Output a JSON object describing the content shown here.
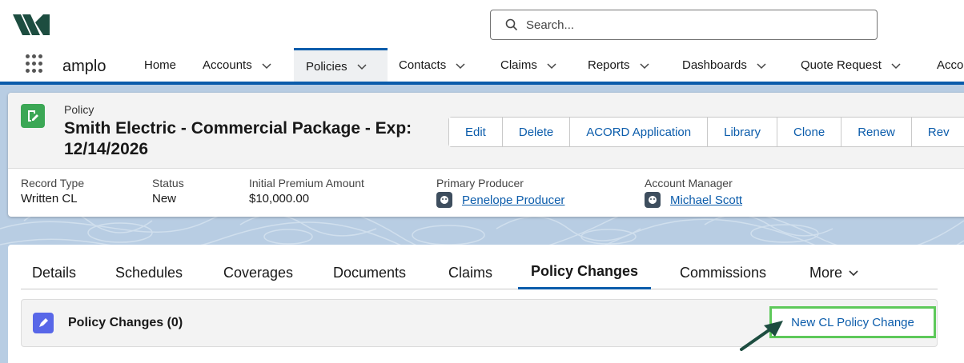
{
  "search": {
    "placeholder": "Search..."
  },
  "nav": {
    "app_name": "amplo",
    "items": [
      {
        "label": "Home"
      },
      {
        "label": "Accounts"
      },
      {
        "label": "Policies"
      },
      {
        "label": "Contacts"
      },
      {
        "label": "Claims"
      },
      {
        "label": "Reports"
      },
      {
        "label": "Dashboards"
      },
      {
        "label": "Quote Request"
      },
      {
        "label": "Acco"
      }
    ],
    "active": "Policies"
  },
  "record": {
    "object_label": "Policy",
    "title": "Smith Electric - Commercial Package - Exp: 12/14/2026",
    "buttons": [
      "Edit",
      "Delete",
      "ACORD Application",
      "Library",
      "Clone",
      "Renew",
      "Rev"
    ],
    "fields": [
      {
        "label": "Record Type",
        "value": "Written CL"
      },
      {
        "label": "Status",
        "value": "New"
      },
      {
        "label": "Initial Premium Amount",
        "value": "$10,000.00"
      },
      {
        "label": "Primary Producer",
        "value": "Penelope Producer"
      },
      {
        "label": "Account Manager",
        "value": "Michael Scott"
      }
    ]
  },
  "tabs": {
    "items": [
      "Details",
      "Schedules",
      "Coverages",
      "Documents",
      "Claims",
      "Policy Changes",
      "Commissions",
      "More"
    ],
    "active": "Policy Changes"
  },
  "related": {
    "title": "Policy Changes (0)",
    "new_button": "New CL Policy Change"
  },
  "colors": {
    "brand_blue": "#0b5cab",
    "policy_icon": "#3ba755",
    "related_icon": "#5867e8",
    "highlight": "#5ec95a",
    "arrow": "#1d4d40"
  }
}
